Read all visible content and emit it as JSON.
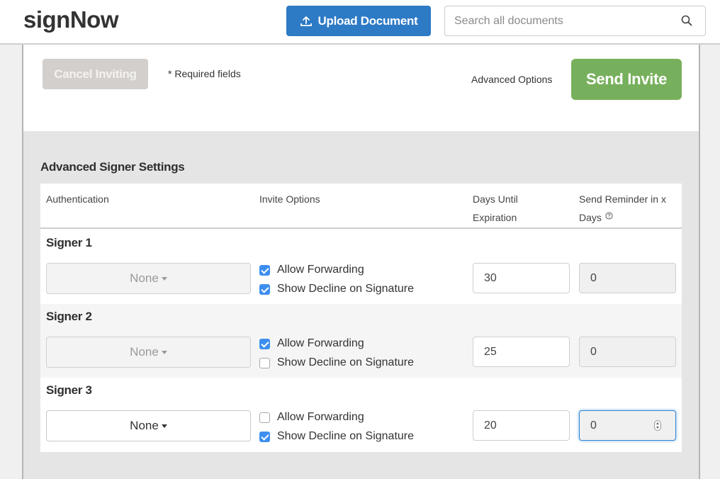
{
  "header": {
    "logo": "signNow",
    "upload_label": "Upload Document",
    "upload_icon": "upload-icon",
    "search_placeholder": "Search all documents",
    "search_value": "",
    "search_icon": "search-icon"
  },
  "actions": {
    "cancel_label": "Cancel Inviting",
    "required_note": "* Required fields",
    "advanced_options_label": "Advanced Options",
    "send_label": "Send Invite"
  },
  "colors": {
    "brand_blue": "#2d7ac5",
    "send_green": "#77b05c",
    "checkbox_blue": "#3d8ef0",
    "cancel_disabled": "#d3cfcc"
  },
  "advanced": {
    "title": "Advanced Signer Settings",
    "columns": {
      "authentication": "Authentication",
      "invite_options": "Invite Options",
      "days_until_expiration": "Days Until Expiration",
      "send_reminder": "Send Reminder in x Days",
      "send_reminder_help_icon": "help-circle-icon"
    },
    "signers": [
      {
        "label": "Signer 1",
        "authentication": "None",
        "auth_enabled": false,
        "allow_forwarding_label": "Allow Forwarding",
        "allow_forwarding": true,
        "show_decline_label": "Show Decline on Signature",
        "show_decline": true,
        "days_until_expiration": "30",
        "reminder_days": "0",
        "reminder_focused": false
      },
      {
        "label": "Signer 2",
        "authentication": "None",
        "auth_enabled": false,
        "allow_forwarding_label": "Allow Forwarding",
        "allow_forwarding": true,
        "show_decline_label": "Show Decline on Signature",
        "show_decline": false,
        "days_until_expiration": "25",
        "reminder_days": "0",
        "reminder_focused": false
      },
      {
        "label": "Signer 3",
        "authentication": "None",
        "auth_enabled": true,
        "allow_forwarding_label": "Allow Forwarding",
        "allow_forwarding": false,
        "show_decline_label": "Show Decline on Signature",
        "show_decline": true,
        "days_until_expiration": "20",
        "reminder_days": "0",
        "reminder_focused": true
      }
    ]
  }
}
